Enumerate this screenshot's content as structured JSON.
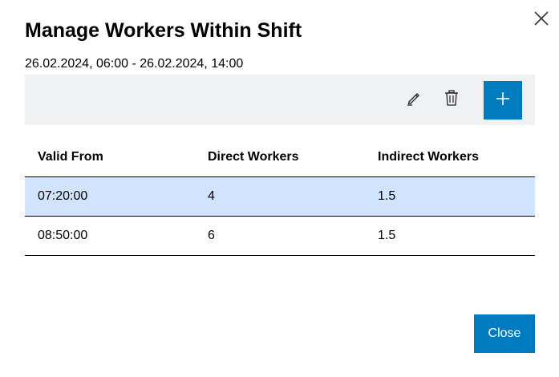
{
  "dialog": {
    "title": "Manage Workers Within Shift",
    "subtitle": "26.02.2024, 06:00 - 26.02.2024, 14:00",
    "close_button_label": "Close"
  },
  "toolbar": {
    "edit_icon": "pencil-icon",
    "delete_icon": "trash-icon",
    "add_icon": "plus-icon"
  },
  "table": {
    "columns": [
      "Valid From",
      "Direct Workers",
      "Indirect Workers"
    ],
    "rows": [
      {
        "valid_from": "07:20:00",
        "direct": "4",
        "indirect": "1.5",
        "selected": true
      },
      {
        "valid_from": "08:50:00",
        "direct": "6",
        "indirect": "1.5",
        "selected": false
      }
    ]
  },
  "colors": {
    "accent": "#007bc0",
    "toolbar_bg": "#eff1f2",
    "selected_row": "#d1e4ff"
  }
}
